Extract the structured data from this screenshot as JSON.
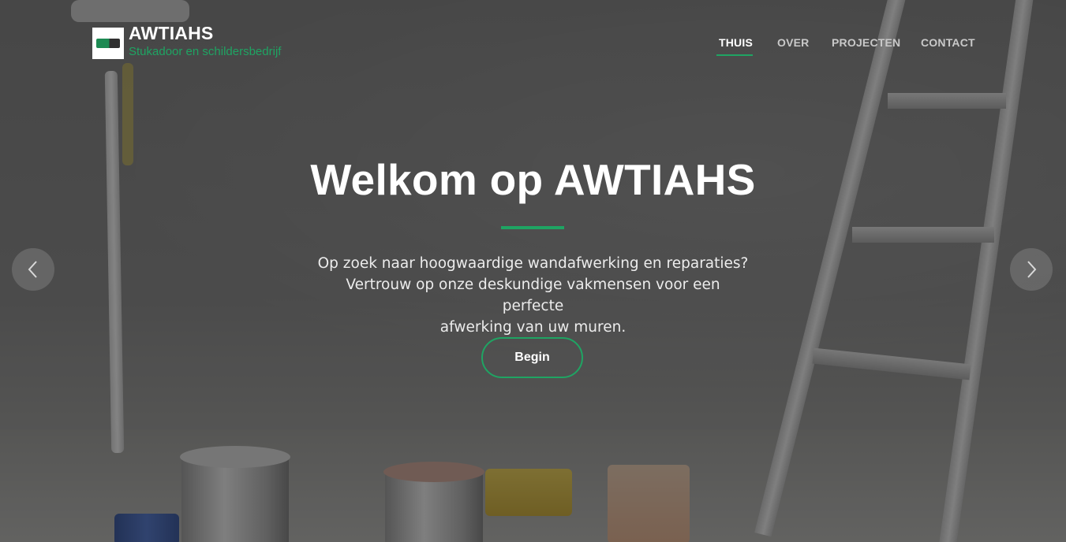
{
  "brand": {
    "name": "AWTIAHS",
    "tagline": "Stukadoor en schildersbedrijf"
  },
  "nav": {
    "items": [
      {
        "label": "THUIS",
        "active": true
      },
      {
        "label": "OVER",
        "active": false
      },
      {
        "label": "PROJECTEN",
        "active": false
      },
      {
        "label": "CONTACT",
        "active": false
      }
    ]
  },
  "hero": {
    "title": "Welkom op AWTIAHS",
    "lines": [
      "Op zoek naar hoogwaardige wandafwerking en reparaties?",
      "Vertrouw op onze deskundige vakmensen voor een perfecte",
      "afwerking van uw muren."
    ],
    "cta_label": "Begin"
  },
  "carousel": {
    "prev_icon": "chevron-left-icon",
    "next_icon": "chevron-right-icon"
  },
  "colors": {
    "accent": "#1fa463",
    "text_light": "#ffffff",
    "nav_inactive": "#c9c9c9"
  }
}
